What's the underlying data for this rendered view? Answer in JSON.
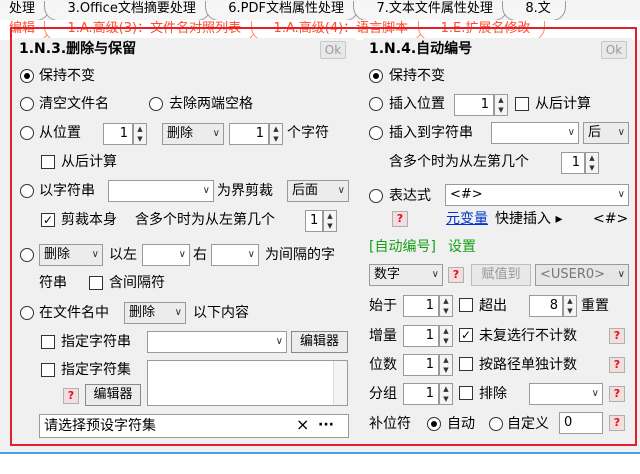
{
  "tabs_row1": [
    "处理",
    "3.Office文档摘要处理",
    "6.PDF文档属性处理",
    "7.文本文件属性处理",
    "8.文"
  ],
  "tabs_row2": [
    "编辑",
    "1.A.高级(3)：文件名对照列表",
    "1.A.高级(4)：语言脚本",
    "1.E.扩展名修改"
  ],
  "left": {
    "title": "1.N.3.删除与保留",
    "ok_label": "Ok",
    "keep": "保持不变",
    "clear_name": "清空文件名",
    "trim_spaces": "去除两端空格",
    "from_pos": {
      "label": "从位置",
      "value": "1",
      "mode": "删除",
      "count": "1",
      "unit": "个字符",
      "from_end": "从后计算"
    },
    "by_string": {
      "label": "以字符串",
      "value": "",
      "boundary": "为界剪裁",
      "side": "后面",
      "cut_self": "剪裁本身",
      "multi": "含多个时为从左第几个",
      "nth": "1"
    },
    "delimited": {
      "mode": "删除",
      "left": "以左",
      "left_val": "",
      "right": "右",
      "right_val": "",
      "desc": "为间隔的字",
      "desc2": "符串",
      "include": "含间隔符"
    },
    "in_name": {
      "label": "在文件名中",
      "mode": "删除",
      "desc": "以下内容"
    },
    "specify_string": "指定字符串",
    "specify_set": "指定字符集",
    "editor": "编辑器",
    "help": "?",
    "preset_placeholder": "请选择预设字符集",
    "clear_x": "×",
    "more": "···"
  },
  "right": {
    "title": "1.N.4.自动编号",
    "ok_label": "Ok",
    "keep": "保持不变",
    "insert_pos": {
      "label": "插入位置",
      "value": "1",
      "from_end": "从后计算"
    },
    "insert_str": {
      "label": "插入到字符串",
      "value": "",
      "side": "后"
    },
    "multi": "含多个时为从左第几个",
    "multi_val": "1",
    "expr": {
      "label": "表达式",
      "value": "<#>"
    },
    "help": "?",
    "meta_var": "元变量",
    "quick_insert": "快捷插入 ▸",
    "quick_token": "<#>",
    "settings_tag": "[自动编号]",
    "settings_label": "设置",
    "type": "数字",
    "assign": "赋值到",
    "assign_target": "<USER0>",
    "rows": [
      {
        "label": "始于",
        "value": "1",
        "check": "超出",
        "num": "8",
        "tail": "重置"
      },
      {
        "label": "增量",
        "value": "1",
        "check": "未复选行不计数",
        "checked": true
      },
      {
        "label": "位数",
        "value": "1",
        "check": "按路径单独计数"
      },
      {
        "label": "分组",
        "value": "1",
        "check": "排除",
        "combo": ""
      }
    ],
    "pad_label": "补位符",
    "pad_auto": "自动",
    "pad_custom": "自定义",
    "pad_value": "0"
  }
}
